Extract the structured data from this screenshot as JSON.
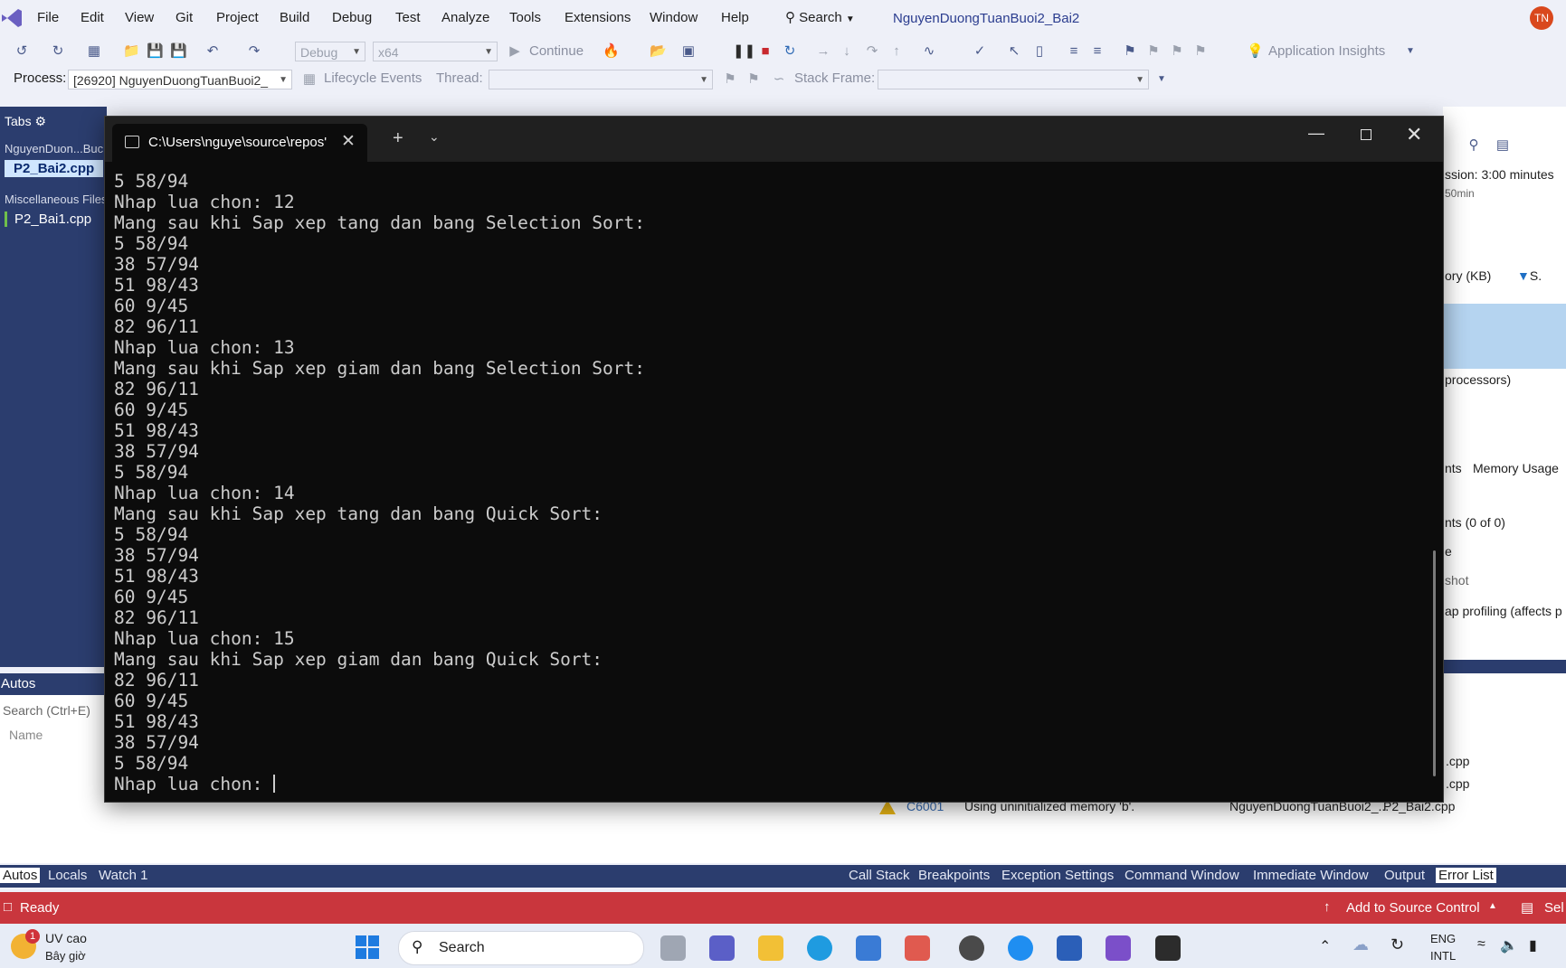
{
  "menubar": {
    "items": [
      "File",
      "Edit",
      "View",
      "Git",
      "Project",
      "Build",
      "Debug",
      "Test",
      "Analyze",
      "Tools",
      "Extensions",
      "Window",
      "Help"
    ],
    "search_label": "Search",
    "solution_name": "NguyenDuongTuanBuoi2_Bai2",
    "avatar_initials": "TN"
  },
  "toolbar": {
    "config": "Debug",
    "platform": "x64",
    "continue_label": "Continue",
    "app_insights": "Application Insights"
  },
  "debug_toolbar": {
    "process_label": "Process:",
    "process_value": "[26920] NguyenDuongTuanBuoi2_",
    "lifecycle_label": "Lifecycle Events",
    "thread_label": "Thread:",
    "stack_frame_label": "Stack Frame:"
  },
  "left_panel": {
    "header": "Tabs",
    "group1": "NguyenDuon...Buc",
    "file1": "P2_Bai2.cpp",
    "group2": "Miscellaneous Files",
    "file2": "P2_Bai1.cpp"
  },
  "right_panel": {
    "session": "ssion: 3:00 minutes",
    "timescale": "50min",
    "memory_col": "ory (KB)",
    "s_label": "S.",
    "processors": "processors)",
    "tab_events": "nts",
    "tab_memory": "Memory Usage",
    "events_count": "nts (0 of 0)",
    "e_label": "e",
    "snapshot": "shot",
    "heap_profiling": "ap profiling (affects p"
  },
  "autos": {
    "title": "Autos",
    "search_placeholder": "Search (Ctrl+E)",
    "name_col": "Name"
  },
  "error_list": {
    "rows": [
      ".cpp",
      ".cpp"
    ],
    "warning_code": "C6001",
    "warning_text": "Using uninitialized memory 'b'.",
    "warning_project": "NguyenDuongTuanBuoi2_...",
    "warning_file": "P2_Bai2.cpp"
  },
  "bottom_tabs_left": [
    "Autos",
    "Locals",
    "Watch 1"
  ],
  "bottom_tabs_right": [
    "Call Stack",
    "Breakpoints",
    "Exception Settings",
    "Command Window",
    "Immediate Window",
    "Output",
    "Error List"
  ],
  "statusbar": {
    "ready": "Ready",
    "source_control": "Add to Source Control",
    "select": "Sel"
  },
  "terminal": {
    "tab_title": "C:\\Users\\nguye\\source\\repos'",
    "lines": [
      "5 58/94",
      "Nhap lua chon: 12",
      "Mang sau khi Sap xep tang dan bang Selection Sort:",
      "5 58/94",
      "38 57/94",
      "51 98/43",
      "60 9/45",
      "82 96/11",
      "Nhap lua chon: 13",
      "Mang sau khi Sap xep giam dan bang Selection Sort:",
      "82 96/11",
      "60 9/45",
      "51 98/43",
      "38 57/94",
      "5 58/94",
      "Nhap lua chon: 14",
      "Mang sau khi Sap xep tang dan bang Quick Sort:",
      "5 58/94",
      "38 57/94",
      "51 98/43",
      "60 9/45",
      "82 96/11",
      "Nhap lua chon: 15",
      "Mang sau khi Sap xep giam dan bang Quick Sort:",
      "82 96/11",
      "60 9/45",
      "51 98/43",
      "38 57/94",
      "5 58/94"
    ],
    "prompt": "Nhap lua chon: "
  },
  "taskbar": {
    "weather_title": "UV cao",
    "weather_sub": "Bây giờ",
    "weather_badge": "1",
    "search_label": "Search",
    "lang_top": "ENG",
    "lang_bottom": "INTL"
  }
}
